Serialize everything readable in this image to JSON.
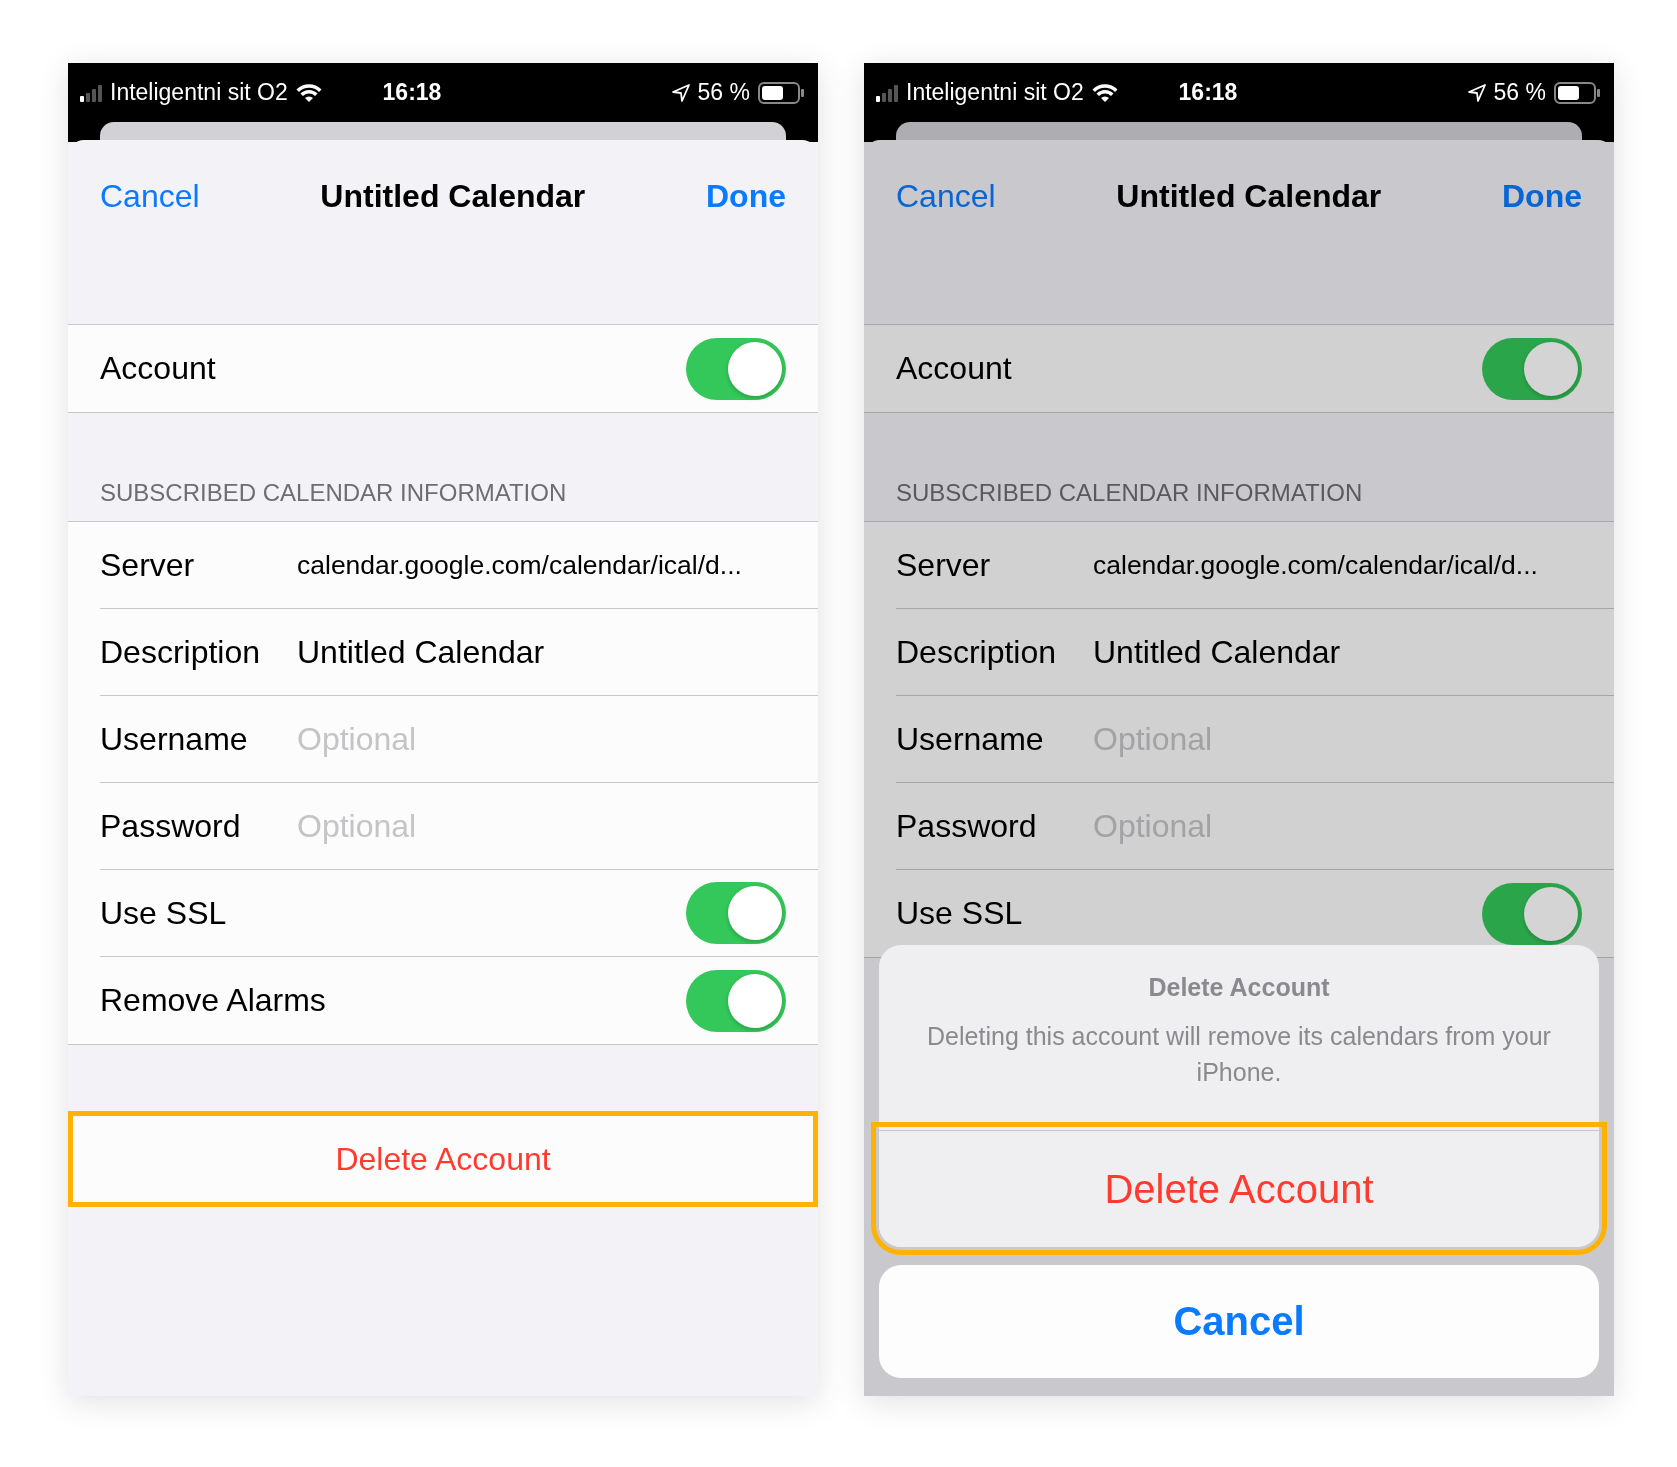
{
  "screens": [
    {
      "dimmed": false,
      "status_bar": {
        "carrier": "Inteligentni sit O2",
        "time": "16:18",
        "battery": "56 %"
      },
      "nav": {
        "cancel": "Cancel",
        "title": "Untitled Calendar",
        "done": "Done"
      },
      "account": {
        "label": "Account",
        "on": true
      },
      "section_header": "SUBSCRIBED CALENDAR INFORMATION",
      "rows": [
        {
          "kind": "value",
          "label": "Server",
          "value": "calendar.google.com/calendar/ical/d..."
        },
        {
          "kind": "value",
          "label": "Description",
          "value": "Untitled Calendar"
        },
        {
          "kind": "field",
          "label": "Username",
          "placeholder": "Optional"
        },
        {
          "kind": "field",
          "label": "Password",
          "placeholder": "Optional"
        },
        {
          "kind": "toggle",
          "label": "Use SSL",
          "on": true
        },
        {
          "kind": "toggle",
          "label": "Remove Alarms",
          "on": true
        }
      ],
      "delete_button": {
        "label": "Delete Account",
        "highlighted": true
      }
    },
    {
      "dimmed": true,
      "status_bar": {
        "carrier": "Inteligentni sit O2",
        "time": "16:18",
        "battery": "56 %"
      },
      "nav": {
        "cancel": "Cancel",
        "title": "Untitled Calendar",
        "done": "Done"
      },
      "account": {
        "label": "Account",
        "on": true
      },
      "section_header": "SUBSCRIBED CALENDAR INFORMATION",
      "rows": [
        {
          "kind": "value",
          "label": "Server",
          "value": "calendar.google.com/calendar/ical/d..."
        },
        {
          "kind": "value",
          "label": "Description",
          "value": "Untitled Calendar"
        },
        {
          "kind": "field",
          "label": "Username",
          "placeholder": "Optional"
        },
        {
          "kind": "field",
          "label": "Password",
          "placeholder": "Optional"
        },
        {
          "kind": "toggle",
          "label": "Use SSL",
          "on": true
        }
      ],
      "action_sheet": {
        "title": "Delete Account",
        "message": "Deleting this account will remove its calendars from your iPhone.",
        "delete": {
          "label": "Delete Account",
          "highlighted": true
        },
        "cancel": "Cancel"
      }
    }
  ]
}
